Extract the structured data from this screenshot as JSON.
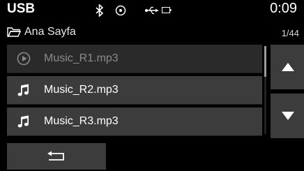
{
  "status": {
    "source": "USB",
    "time": "0:09",
    "icons": [
      "bluetooth-icon",
      "cd-icon",
      "usb-icon",
      "battery-icon"
    ]
  },
  "breadcrumb": {
    "label": "Ana Sayfa",
    "page_count": "1/44",
    "icon": "folder-icon"
  },
  "list": {
    "items": [
      {
        "label": "Music_R1.mp3",
        "icon": "play-circle-icon",
        "state": "selected"
      },
      {
        "label": "Music_R2.mp3",
        "icon": "music-note-icon",
        "state": "normal"
      },
      {
        "label": "Music_R3.mp3",
        "icon": "music-note-icon",
        "state": "normal"
      }
    ]
  },
  "controls": {
    "scroll_up_icon": "arrow-up-icon",
    "scroll_down_icon": "arrow-down-icon",
    "back_icon": "back-arrow-icon"
  },
  "colors": {
    "background": "#000000",
    "button": "#3c3c3c",
    "selected_item": "#2a2a2a",
    "selected_text": "#8a8a8a",
    "text": "#ffffff"
  }
}
